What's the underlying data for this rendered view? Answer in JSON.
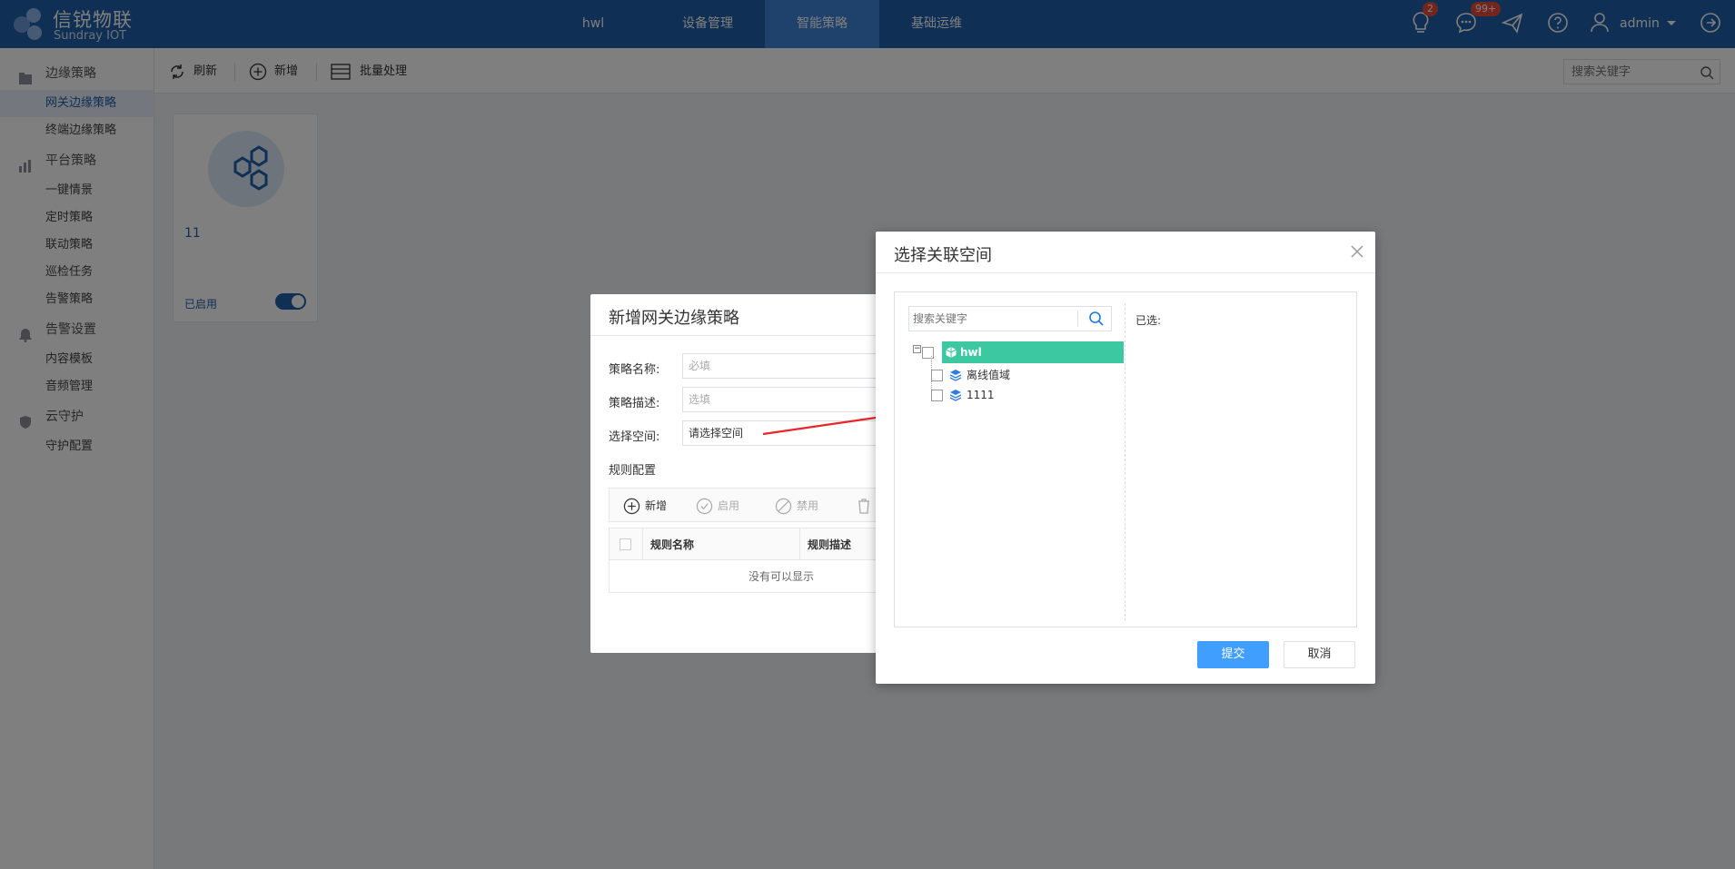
{
  "brand": {
    "name": "信锐物联",
    "sub": "Sundray IOT"
  },
  "nav": [
    {
      "label": "hwl",
      "active": false
    },
    {
      "label": "设备管理",
      "active": false
    },
    {
      "label": "智能策略",
      "active": true
    },
    {
      "label": "基础运维",
      "active": false
    }
  ],
  "header": {
    "bulb_badge": "2",
    "message_badge": "99+",
    "user": "admin"
  },
  "sidebar": {
    "groups": [
      {
        "label": "边缘策略",
        "icon": "folder-icon",
        "items": [
          "网关边缘策略",
          "终端边缘策略"
        ]
      },
      {
        "label": "平台策略",
        "icon": "chart-icon",
        "items": [
          "一键情景",
          "定时策略",
          "联动策略",
          "巡检任务",
          "告警策略"
        ]
      },
      {
        "label": "告警设置",
        "icon": "bell-icon",
        "items": [
          "内容模板",
          "音频管理"
        ]
      },
      {
        "label": "云守护",
        "icon": "shield-icon",
        "items": [
          "守护配置"
        ]
      }
    ],
    "active_item": "网关边缘策略"
  },
  "toolbar": {
    "refresh": "刷新",
    "add": "新增",
    "batch": "批量处理",
    "search_placeholder": "搜索关键字"
  },
  "card": {
    "name": "11",
    "status": "已启用",
    "enabled": true
  },
  "back_dialog": {
    "title": "新增网关边缘策略",
    "fields": [
      {
        "label": "策略名称:",
        "value": "必填",
        "is_placeholder": true
      },
      {
        "label": "策略描述:",
        "value": "选填",
        "is_placeholder": true
      },
      {
        "label": "选择空间:",
        "value": "请选择空间",
        "is_placeholder": false
      }
    ],
    "rules_title": "规则配置",
    "rules_toolbar": {
      "add": "新增",
      "enable": "启用",
      "disable": "禁用"
    },
    "rules_columns": [
      "规则名称",
      "规则描述"
    ],
    "rules_empty": "没有可以显示"
  },
  "dialog": {
    "title": "选择关联空间",
    "search_placeholder": "搜索关键字",
    "selected_label": "已选:",
    "tree": {
      "root": "hwl",
      "children": [
        "离线值域",
        "1111"
      ]
    },
    "submit": "提交",
    "cancel": "取消"
  },
  "colors": {
    "topbar": "#1f5fa8",
    "nav_active": "#3d84d8",
    "tree_selected": "#3cc8a0",
    "primary_button": "#409eff",
    "arrow": "#e8262a"
  }
}
